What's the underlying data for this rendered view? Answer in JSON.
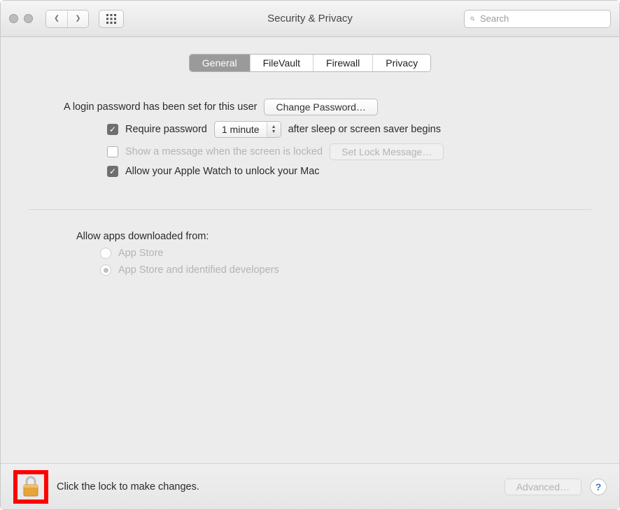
{
  "window": {
    "title": "Security & Privacy"
  },
  "search": {
    "placeholder": "Search"
  },
  "tabs": {
    "general": "General",
    "filevault": "FileVault",
    "firewall": "Firewall",
    "privacy": "Privacy"
  },
  "login": {
    "status_text": "A login password has been set for this user",
    "change_password_btn": "Change Password…",
    "require_pw_label": "Require password",
    "require_pw_delay": "1 minute",
    "require_pw_tail": "after sleep or screen saver begins",
    "show_message_label": "Show a message when the screen is locked",
    "set_lock_message_btn": "Set Lock Message…",
    "apple_watch_label": "Allow your Apple Watch to unlock your Mac"
  },
  "gatekeeper": {
    "heading": "Allow apps downloaded from:",
    "opt_app_store": "App Store",
    "opt_identified": "App Store and identified developers"
  },
  "footer": {
    "lock_text": "Click the lock to make changes.",
    "advanced_btn": "Advanced…"
  }
}
